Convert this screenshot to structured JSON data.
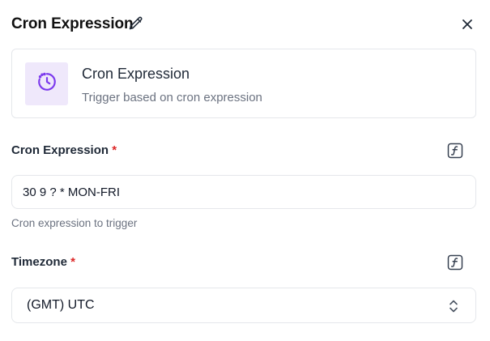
{
  "header": {
    "title": "Cron Expression",
    "edit_icon": "pencil-icon",
    "close_icon": "close-icon"
  },
  "card": {
    "icon": "clock-timer-icon",
    "title": "Cron Expression",
    "subtitle": "Trigger based on cron expression"
  },
  "fields": {
    "cron": {
      "label": "Cron Expression",
      "required_marker": "*",
      "value": "30 9 ? * MON-FRI",
      "helper": "Cron expression to trigger",
      "fx_icon": "function-icon"
    },
    "timezone": {
      "label": "Timezone",
      "required_marker": "*",
      "selected": "(GMT) UTC",
      "fx_icon": "function-icon",
      "chevron_icon": "chevron-up-down-icon"
    }
  },
  "colors": {
    "accent": "#7c3aed",
    "accent_bg": "#efe8fb",
    "required": "#dc2626",
    "border": "#e5e7eb",
    "muted_text": "#6b7280"
  }
}
